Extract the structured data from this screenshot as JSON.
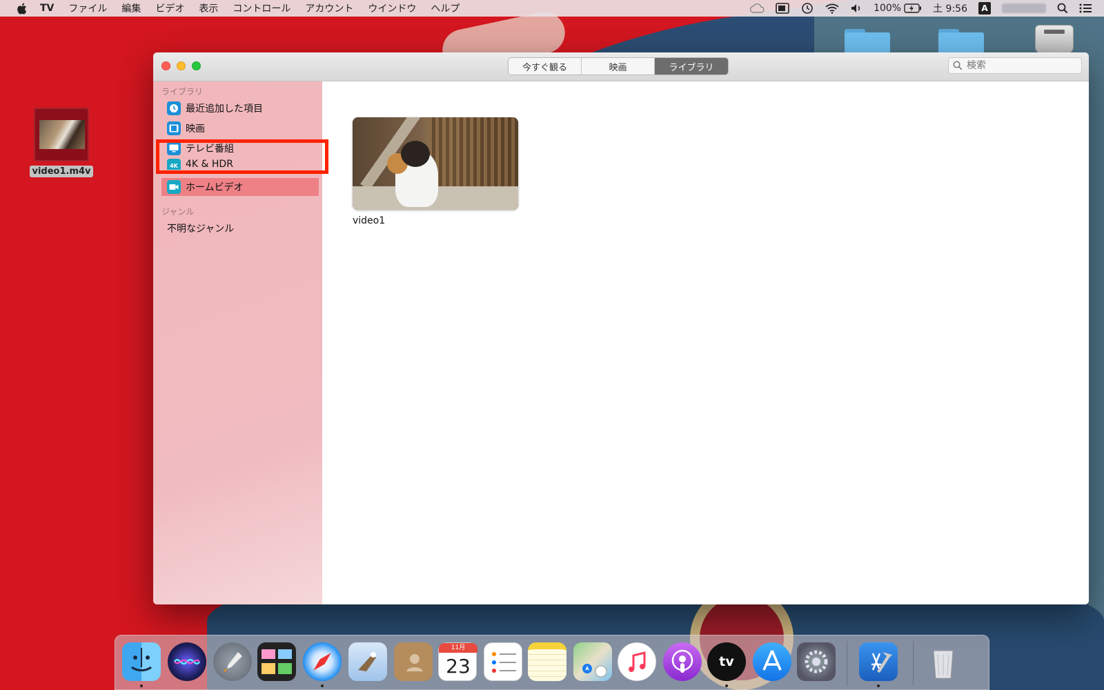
{
  "menubar": {
    "app_name": "TV",
    "items": [
      "ファイル",
      "編集",
      "ビデオ",
      "表示",
      "コントロール",
      "アカウント",
      "ウインドウ",
      "ヘルプ"
    ],
    "battery": "100%",
    "clock": "土 9:56",
    "input_source": "A"
  },
  "desktop": {
    "file_label": "video1.m4v"
  },
  "window": {
    "tabs": [
      {
        "label": "今すぐ観る",
        "active": false
      },
      {
        "label": "映画",
        "active": false
      },
      {
        "label": "ライブラリ",
        "active": true
      }
    ],
    "search": {
      "placeholder": "検索"
    },
    "sidebar": {
      "section_library": "ライブラリ",
      "items": [
        {
          "label": "最近追加した項目",
          "icon": "clock-icon"
        },
        {
          "label": "映画",
          "icon": "film-icon"
        },
        {
          "label": "テレビ番組",
          "icon": "tv-icon"
        },
        {
          "label": "4K & HDR",
          "icon": "4k-icon"
        },
        {
          "label": "ホームビデオ",
          "icon": "video-camera-icon",
          "selected": true
        }
      ],
      "section_genre": "ジャンル",
      "genres": [
        "不明なジャンル"
      ]
    },
    "content": {
      "videos": [
        {
          "title": "video1"
        }
      ]
    }
  },
  "dock": {
    "calendar_month": "11月",
    "calendar_day": "23",
    "tv_label": "tv",
    "apps": [
      "finder",
      "siri",
      "launchpad",
      "photo-booth",
      "safari",
      "mail",
      "contacts",
      "calendar",
      "reminders",
      "notes",
      "maps",
      "music",
      "podcasts",
      "apple-tv",
      "app-store",
      "system-preferences",
      "xcode",
      "trash"
    ]
  },
  "colors": {
    "selection_highlight": "#ff2200",
    "sidebar_selected": "#ee8186",
    "sidebar_bg": "#f1b7bb",
    "segment_active": "#6d6d6d"
  }
}
